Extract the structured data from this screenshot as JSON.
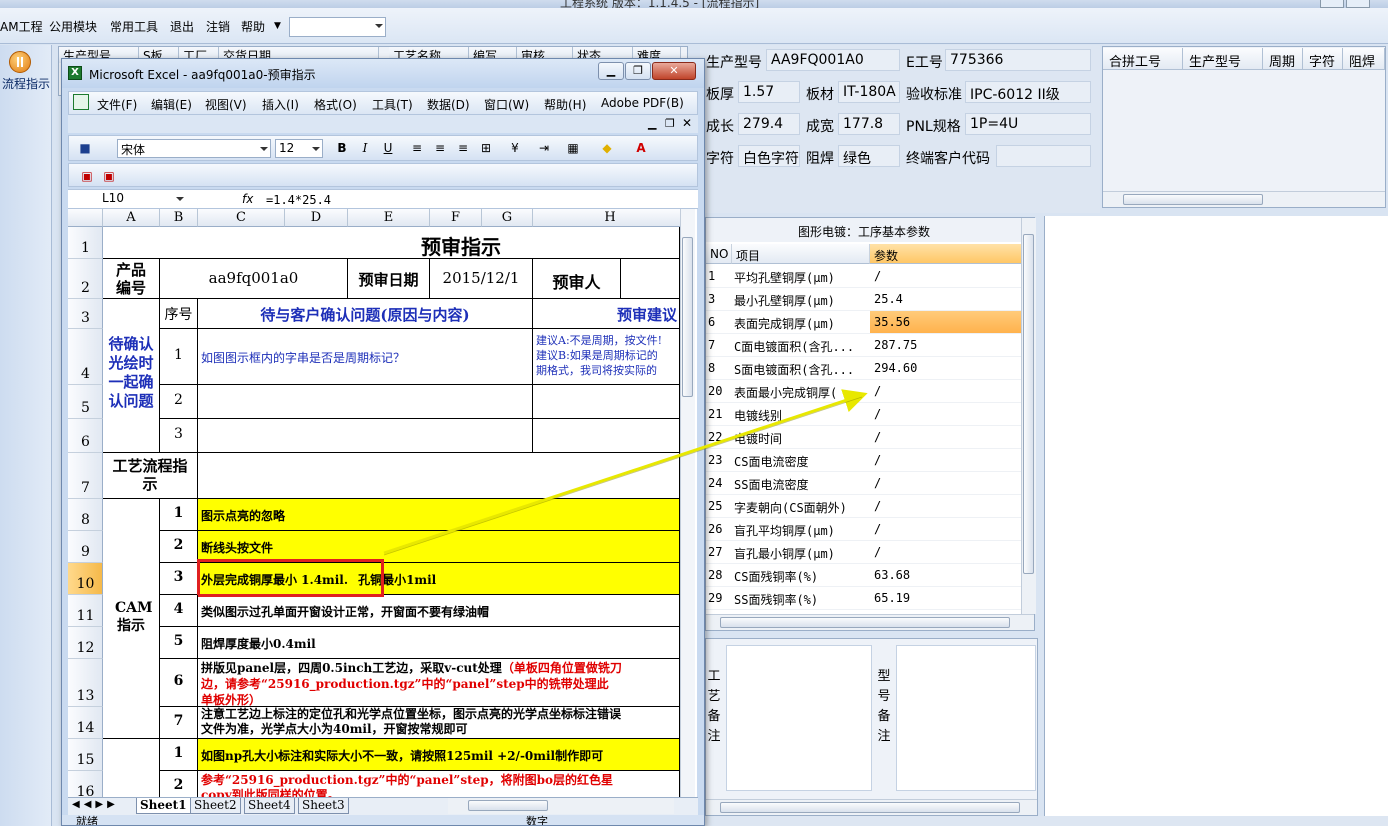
{
  "window": {
    "title_partial": "工程系统 版本：1.1.4.5 - [流程指示]"
  },
  "menubar": {
    "items": [
      "AM工程",
      "公用模块",
      "常用工具",
      "退出",
      "注销",
      "帮助"
    ],
    "dropdown_value": ""
  },
  "leftnav": {
    "item_label": "流程指示"
  },
  "bg_grid": {
    "headers": [
      "生产型号",
      "S板",
      "工厂",
      "交货日期",
      "工艺名称",
      "编写",
      "审核",
      "状态",
      "难度"
    ]
  },
  "info": {
    "product_model_label": "生产型号",
    "product_model": "AA9FQ001A0",
    "e_no_label": "E工号",
    "e_no": "775366",
    "thickness_label": "板厚",
    "thickness": "1.57",
    "material_label": "板材",
    "material": "IT-180A",
    "standard_label": "验收标准",
    "standard": "IPC-6012 II级",
    "length_label": "成长",
    "length": "279.4",
    "width_label": "成宽",
    "width": "177.8",
    "pnl_label": "PNL规格",
    "pnl": "1P=4U",
    "legend_label": "字符",
    "legend": "白色字符",
    "mask_label": "阻焊",
    "mask": "绿色",
    "customer_code_label": "终端客户代码",
    "customer_code": ""
  },
  "merge_grid": {
    "headers": [
      "合拼工号",
      "生产型号",
      "周期",
      "字符",
      "阻焊"
    ]
  },
  "params": {
    "title": "图形电镀：工序基本参数",
    "headers": {
      "no": "NO",
      "item": "项目",
      "value": "参数"
    },
    "rows": [
      {
        "no": "1",
        "item": "平均孔壁铜厚(μm)",
        "value": "/"
      },
      {
        "no": "3",
        "item": "最小孔壁铜厚(μm)",
        "value": "25.4"
      },
      {
        "no": "6",
        "item": "表面完成铜厚(μm)",
        "value": "35.56"
      },
      {
        "no": "7",
        "item": "C面电镀面积(含孔...",
        "value": "287.75"
      },
      {
        "no": "8",
        "item": "S面电镀面积(含孔...",
        "value": "294.60"
      },
      {
        "no": "20",
        "item": "表面最小完成铜厚(",
        "value": "/"
      },
      {
        "no": "21",
        "item": "电镀线别",
        "value": "/"
      },
      {
        "no": "22",
        "item": "电镀时间",
        "value": "/"
      },
      {
        "no": "23",
        "item": "CS面电流密度",
        "value": "/"
      },
      {
        "no": "24",
        "item": "SS面电流密度",
        "value": "/"
      },
      {
        "no": "25",
        "item": "字麦朝向(CS面朝外)",
        "value": "/"
      },
      {
        "no": "26",
        "item": "盲孔平均铜厚(μm)",
        "value": "/"
      },
      {
        "no": "27",
        "item": "盲孔最小铜厚(μm)",
        "value": "/"
      },
      {
        "no": "28",
        "item": "CS面残铜率(%)",
        "value": "63.68"
      },
      {
        "no": "29",
        "item": "SS面残铜率(%)",
        "value": "65.19"
      }
    ]
  },
  "remarks": {
    "process_label": "工艺备注",
    "model_label": "型号备注"
  },
  "excel": {
    "title": "Microsoft Excel - aa9fq001a0-预审指示",
    "menu": [
      "文件(F)",
      "编辑(E)",
      "视图(V)",
      "插入(I)",
      "格式(O)",
      "工具(T)",
      "数据(D)",
      "窗口(W)",
      "帮助(H)",
      "Adobe PDF(B)"
    ],
    "font_name": "宋体",
    "font_size": "12",
    "name_box": "L10",
    "fx": "fx",
    "formula": "=1.4*25.4",
    "columns": [
      "A",
      "B",
      "C",
      "D",
      "E",
      "F",
      "G",
      "H"
    ],
    "rows": [
      "1",
      "2",
      "3",
      "4",
      "5",
      "6",
      "7",
      "8",
      "9",
      "10",
      "11",
      "12",
      "13",
      "14",
      "15",
      "16"
    ],
    "sheet_tabs": [
      "Sheet1",
      "Sheet2",
      "Sheet4",
      "Sheet3"
    ],
    "status": {
      "ready": "就绪",
      "num": "数字"
    },
    "cells": {
      "title": "预审指示",
      "product_no_label": "产品编号",
      "product_no": "aa9fq001a0",
      "review_date_label": "预审日期",
      "review_date": "2015/12/1",
      "reviewer_label": "预审人",
      "seq_label": "序号",
      "pending_header": "待与客户确认问题(原因与内容)",
      "suggestion_header": "预审建议",
      "confirm_group": "待确认光绘时一起确认问题",
      "q1_no": "1",
      "q1_text": "如图图示框内的字串是否是周期标记？",
      "q1_sugg_a": "建议A:不是周期，按文件!",
      "q1_sugg_b": "建议B:如果是周期标记的",
      "q1_sugg_c": "期格式，我司将按实际的",
      "q2_no": "2",
      "q3_no": "3",
      "process_flow_label": "工艺流程指示",
      "cam_label": "CAM指示",
      "i1_no": "1",
      "i1_text": "图示点亮的忽略",
      "i2_no": "2",
      "i2_text": "断线头按文件",
      "i3_no": "3",
      "i3_text": "外层完成铜厚最小 1.4mil.",
      "i3_text_rest": "孔铜最小1mil",
      "i4_no": "4",
      "i4_text": "类似图示过孔单面开窗设计正常，开窗面不要有绿油帽",
      "i5_no": "5",
      "i5_text": "阻焊厚度最小0.4mil",
      "i6_no": "6",
      "i6_text_a": "拼版见panel层，四周0.5inch工艺边，采取v-cut处理",
      "i6_text_red_a": "（单板四角位置做铣刀",
      "i6_text_red_b": "边，请参考“25916_production.tgz”中的“panel”step中的铣带处理此",
      "i6_text_red_c": "单板外形）",
      "i7_no": "7",
      "i7_text_a": "注意工艺边上标注的定位孔和光学点位置坐标，图示点亮的光学点坐标标注错误",
      "i7_text_b": "文件为准，光学点大小为40mil，开窗按常规即可",
      "i8_no": "1",
      "i8_text": "如图np孔大小标注和实际大小不一致，请按照125mil +2/-0mil制作即可",
      "i9_no": "2",
      "i9_text_a": "参考“25916_production.tgz”中的“panel”step，将附图bo层的红色星",
      "i9_text_b": "copy到此版同样的位置。"
    }
  },
  "colors": {
    "highlight_yellow": "#ffff00",
    "annotation_arrow": "#e8e800",
    "box_red": "#e02020",
    "blue_text": "#1d2fb8"
  }
}
